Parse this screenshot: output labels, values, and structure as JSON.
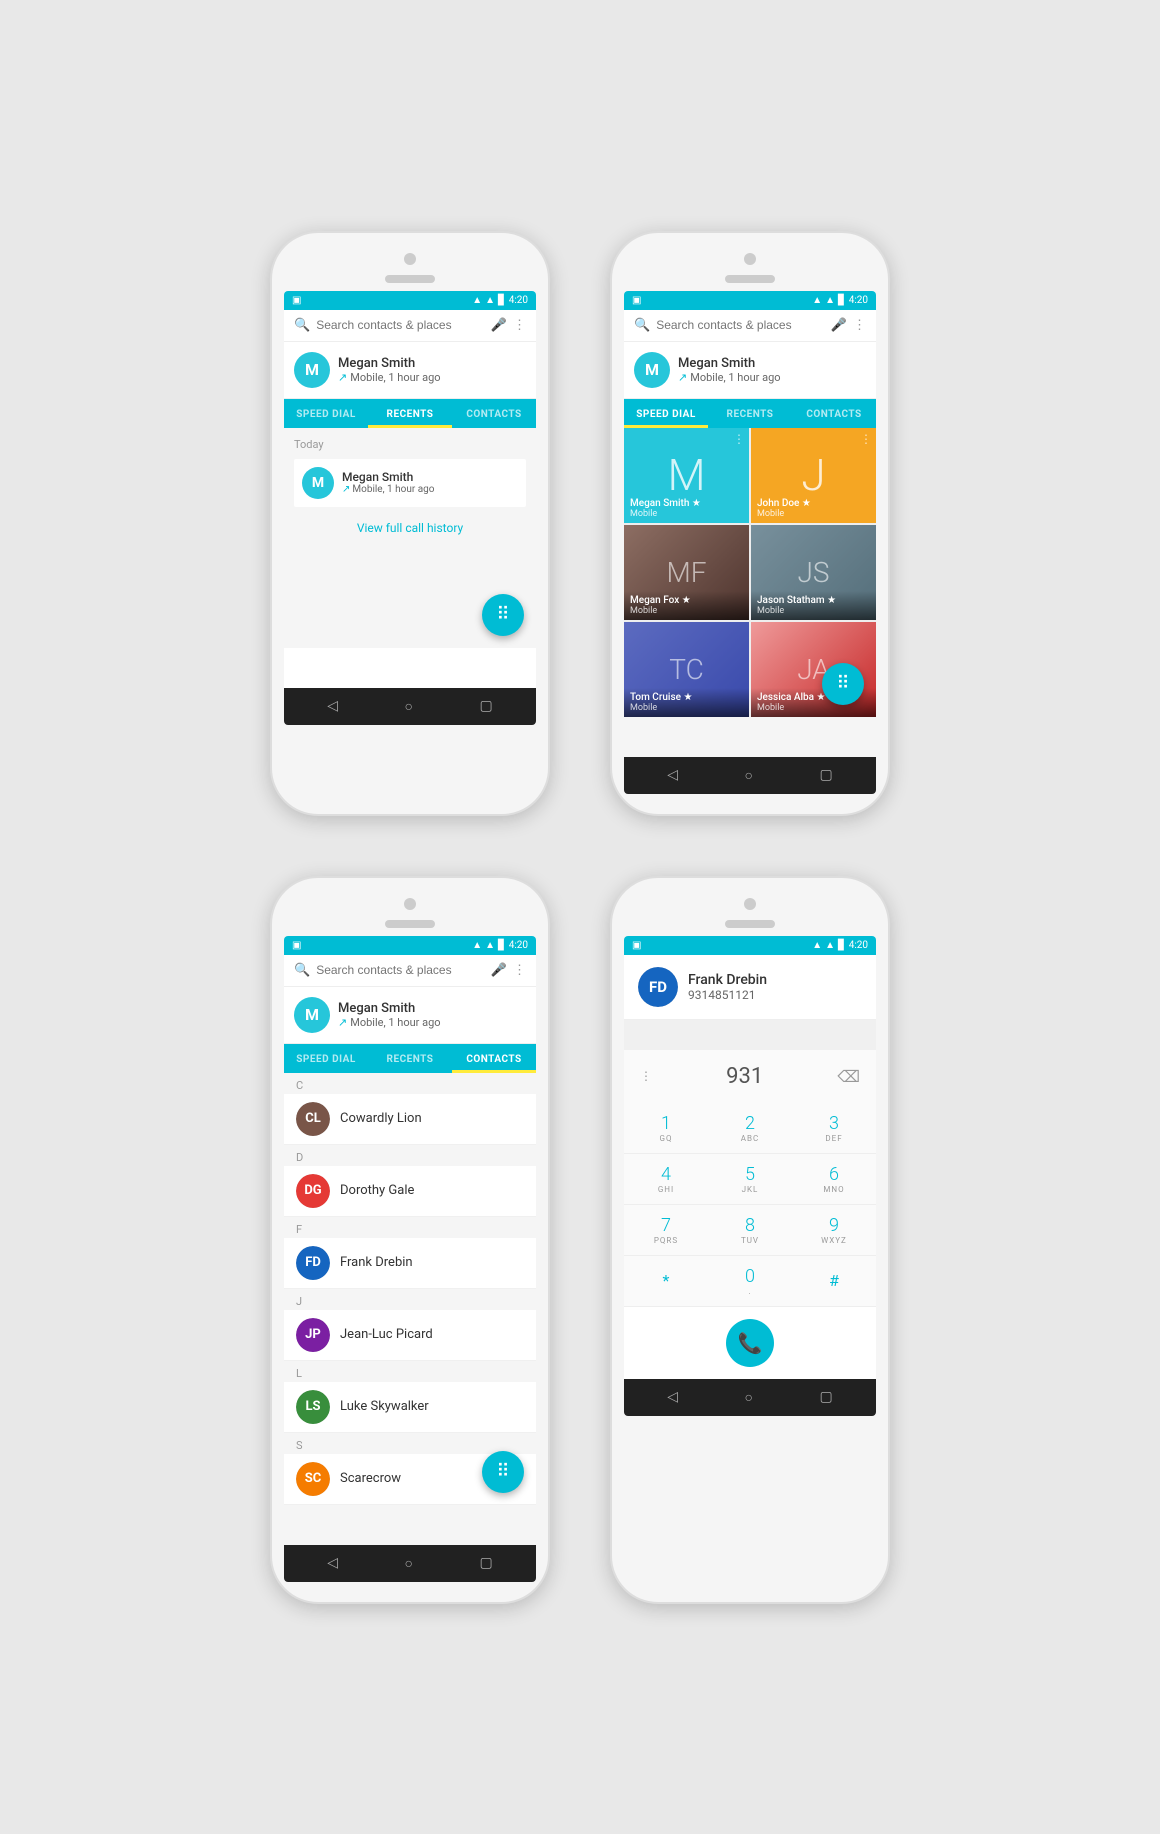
{
  "phones": [
    {
      "id": "phone1",
      "screen": "recents",
      "statusBar": {
        "time": "4:20",
        "icons": [
          "signal",
          "wifi",
          "battery"
        ]
      },
      "searchBar": {
        "placeholder": "Search contacts & places"
      },
      "recentCall": {
        "name": "Megan Smith",
        "detail": "Mobile, 1 hour ago",
        "avatarLetter": "M"
      },
      "tabs": [
        {
          "label": "SPEED DIAL",
          "active": false
        },
        {
          "label": "RECENTS",
          "active": true
        },
        {
          "label": "CONTACTS",
          "active": false
        }
      ],
      "recents": {
        "sectionLabel": "Today",
        "calls": [
          {
            "name": "Megan Smith",
            "detail": "Mobile, 1 hour ago",
            "avatarLetter": "M"
          }
        ],
        "viewHistory": "View full call history"
      }
    },
    {
      "id": "phone2",
      "screen": "speeddial",
      "statusBar": {
        "time": "4:20",
        "icons": [
          "signal",
          "wifi",
          "battery"
        ]
      },
      "searchBar": {
        "placeholder": "Search contacts & places"
      },
      "recentCall": {
        "name": "Megan Smith",
        "detail": "Mobile, 1 hour ago",
        "avatarLetter": "M"
      },
      "tabs": [
        {
          "label": "SPEED DIAL",
          "active": true
        },
        {
          "label": "RECENTS",
          "active": false
        },
        {
          "label": "CONTACTS",
          "active": false
        }
      ],
      "speedDial": {
        "contacts": [
          {
            "type": "letter",
            "letter": "M",
            "bg": "teal",
            "name": "Megan Smith ★",
            "sub": "Mobile"
          },
          {
            "type": "letter",
            "letter": "J",
            "bg": "gold",
            "name": "John Doe ★",
            "sub": "Mobile"
          },
          {
            "type": "photo",
            "colorClass": "color-brown",
            "initials": "MF",
            "name": "Megan Fox ★",
            "sub": "Mobile"
          },
          {
            "type": "photo",
            "colorClass": "color-gray",
            "initials": "JS",
            "name": "Jason Statham ★",
            "sub": "Mobile"
          },
          {
            "type": "photo",
            "colorClass": "color-blue",
            "initials": "TC",
            "name": "Tom Cruise ★",
            "sub": "Mobile"
          },
          {
            "type": "photo",
            "colorClass": "color-red",
            "initials": "JA",
            "name": "Jessica Alba ★",
            "sub": "Mobile"
          }
        ]
      }
    },
    {
      "id": "phone3",
      "screen": "contacts",
      "statusBar": {
        "time": "4:20",
        "icons": [
          "signal",
          "wifi",
          "battery"
        ]
      },
      "searchBar": {
        "placeholder": "Search contacts & places"
      },
      "recentCall": {
        "name": "Megan Smith",
        "detail": "Mobile, 1 hour ago",
        "avatarLetter": "M"
      },
      "tabs": [
        {
          "label": "SPEED DIAL",
          "active": false
        },
        {
          "label": "RECENTS",
          "active": false
        },
        {
          "label": "CONTACTS",
          "active": true
        }
      ],
      "contacts": [
        {
          "letter": "C",
          "name": "Cowardly Lion",
          "colorClass": "color-brown",
          "initials": "CL"
        },
        {
          "letter": "D",
          "name": "Dorothy Gale",
          "colorClass": "color-red",
          "initials": "DG"
        },
        {
          "letter": "F",
          "name": "Frank Drebin",
          "colorClass": "color-blue",
          "initials": "FD"
        },
        {
          "letter": "J",
          "name": "Jean-Luc Picard",
          "colorClass": "color-purple",
          "initials": "JP"
        },
        {
          "letter": "L",
          "name": "Luke Skywalker",
          "colorClass": "color-green",
          "initials": "LS"
        },
        {
          "letter": "S",
          "name": "Scarecrow",
          "colorClass": "color-orange",
          "initials": "SC"
        }
      ]
    },
    {
      "id": "phone4",
      "screen": "dialer",
      "statusBar": {
        "time": "4:20",
        "icons": [
          "signal",
          "wifi",
          "battery"
        ]
      },
      "dialer": {
        "contactName": "Frank Drebin",
        "contactNumber": "9314851121",
        "displayDigits": "931",
        "keys": [
          {
            "num": "1",
            "letters": "GQ"
          },
          {
            "num": "2",
            "letters": "ABC"
          },
          {
            "num": "3",
            "letters": "DEF"
          },
          {
            "num": "4",
            "letters": "GHI"
          },
          {
            "num": "5",
            "letters": "JKL"
          },
          {
            "num": "6",
            "letters": "MNO"
          },
          {
            "num": "7",
            "letters": "PQRS"
          },
          {
            "num": "8",
            "letters": "TUV"
          },
          {
            "num": "9",
            "letters": "WXYZ"
          },
          {
            "num": "*",
            "letters": ""
          },
          {
            "num": "0",
            "letters": "."
          },
          {
            "num": "#",
            "letters": ""
          }
        ]
      }
    }
  ]
}
